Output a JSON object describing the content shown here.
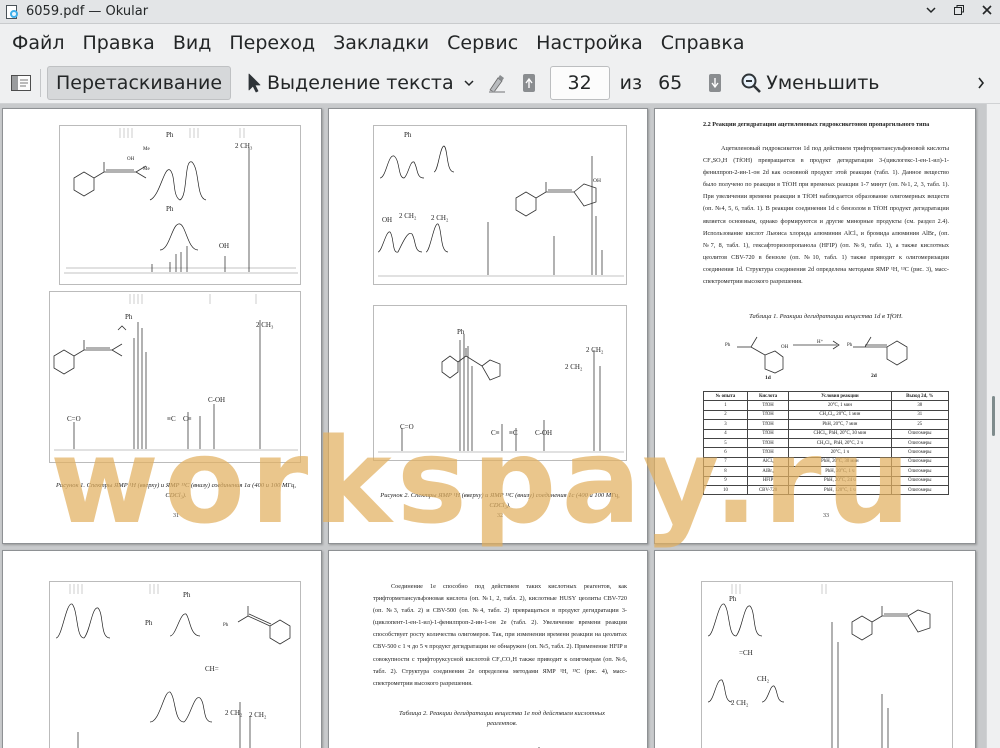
{
  "window": {
    "title": "6059.pdf  — Okular"
  },
  "menubar": {
    "items": [
      "Файл",
      "Правка",
      "Вид",
      "Переход",
      "Закладки",
      "Сервис",
      "Настройка",
      "Справка"
    ]
  },
  "toolbar": {
    "browse_label": "Перетаскивание",
    "select_label": "Выделение текста",
    "page_value": "32",
    "of_label": "из",
    "total_pages": "65",
    "zoom_out_label": "Уменьшить"
  },
  "watermark": "workspay.ru",
  "pages": {
    "p31": {
      "number": "31",
      "caption": "Рисунок 1. Спектры ЯМР ¹H (вверху) и ЯМР ¹³C (внизу) соединения 1a (400 и 100 МГц, CDCl₃).",
      "labels": {
        "ph_top": "Ph",
        "ch3_top": "2 CH₃",
        "ph_mid": "Ph",
        "oh": "OH",
        "me1": "Me",
        "me2": "Me",
        "oh_mol": "OH",
        "ph_c13": "Ph",
        "ch3_c13": "2 CH₃",
        "co": "C=O",
        "cc1": "≡C",
        "cc2": "C≡",
        "coh": "C-OH"
      }
    },
    "p32": {
      "number": "32",
      "caption": "Рисунок 2. Спектры ЯМР ¹H (вверху) и ЯМР ¹³C (внизу) соединения 1c (400 и 100 МГц, CDCl₃).",
      "labels": {
        "ph": "Ph",
        "oh": "OH",
        "ch2_a": "2 CH₂",
        "ch2_b": "2 CH₂",
        "oh_mol": "OH",
        "ph_c13": "Ph",
        "ch2_c13a": "2 CH₂",
        "ch2_c13b": "2 CH₂",
        "co": "C=O",
        "cc1": "C≡",
        "cc2": "≡C",
        "coh": "C-OH"
      }
    },
    "p33": {
      "number": "33",
      "heading": "2.2 Реакции дегидратации ацетиленовых гидроксикетонов пропаргильного типа",
      "paragraphs": [
        "Ацетиленовый гидроксикетон 1d под действием трифторметансульфоновой кислоты CF₃SO₃H (TfOH) превращается в продукт дегидратации 3-(циклогекс-1-ен-1-ил)-1-фенилпроп-2-ин-1-он 2d как основной продукт этой реакции (табл. 1). Данное вещество было получено по реакции в TfOH при временах реакции 1-7 минут (оп. №1, 2, 3, табл. 1). При увеличении времени реакции в TfOH наблюдается образование олигомерных веществ (оп. №4, 5, 6, табл. 1). В реакции соединения 1d с бензолом в TfOH продукт дегидратации является основным, однако формируются и другие минорные продукты (см. раздел 2.4). Использование кислот Льюиса хлорида алюминия AlCl₃ и бромида алюминия AlBr₃ (оп. №7, 8, табл. 1), гексафторизопропанола (HFIP) (оп. №9, табл. 1), а также кислотных цеолитов CBV-720 в бензоле (оп. №10, табл. 1) также приводит к олигомеризации соединения 1d. Структура соединения 2d определена методами ЯМР ¹H, ¹³C (рис. 3), масс-спектрометрии высокого разрешения."
      ],
      "table_caption": "Таблица 1. Реакции дегидратации вещества 1d в TfOH.",
      "scheme": {
        "r1": "1d",
        "r2": "2d",
        "ph": "Ph",
        "oh": "OH",
        "h": "H⁺"
      },
      "table": {
        "headers": [
          "№ опыта",
          "Кислота",
          "Условия реакции",
          "Выход 2d, %"
        ],
        "rows": [
          [
            "1",
            "TfOH",
            "20°C, 1 мин",
            "38"
          ],
          [
            "2",
            "TfOH",
            "CH₂Cl₂, 20°C, 1 мин",
            "31"
          ],
          [
            "3",
            "TfOH",
            "PhH, 20°C, 7 мин",
            "25"
          ],
          [
            "4",
            "TfOH",
            "CHCl₃, PhH, 20°C, 30 мин",
            "Олигомеры"
          ],
          [
            "5",
            "TfOH",
            "CH₂Cl₂, PhH, 20°C, 2 ч",
            "Олигомеры"
          ],
          [
            "6",
            "TfOH",
            "20°C, 1 ч",
            "Олигомеры"
          ],
          [
            "7",
            "AlCl₃",
            "PhH, 20°C, 30 мин",
            "Олигомеры"
          ],
          [
            "8",
            "AlBr₃",
            "PhH, 20°C, 1 ч",
            "Олигомеры"
          ],
          [
            "9",
            "HFIP",
            "PhH, 20°C, 24 ч",
            "Олигомеры"
          ],
          [
            "10",
            "CBV-720",
            "PhH, 120°C, 1 ч",
            "Олигомеры"
          ]
        ]
      }
    },
    "p34": {
      "labels": {
        "ph1": "Ph",
        "ph2": "Ph",
        "ph_mol": "Ph",
        "ch": "CH=",
        "ch2_a": "2 CH₂",
        "ch2_b": "2 CH₂"
      }
    },
    "p35": {
      "paragraph": "Соединение 1e способно под действием таких кислотных реагентов, как трифторметансульфоновая кислота (оп. №1, 2, табл. 2), кислотные HUSY цеолиты CBV-720 (оп. №3, табл. 2) и CBV-500 (оп. №4, табл. 2) превращаться в продукт дегидратации 3-(циклопент-1-ен-1-ил)-1-фенилпроп-2-ин-1-он 2e (табл. 2). Увеличение времени реакции способствует росту количества олигомеров. Так, при изменении времени реакции на цеолитах CBV-500 с 1 ч до 5 ч продукт дегидратации не обнаружен (оп. №5, табл. 2). Применение HFIP в совокупности с трифторуксусной кислотой CF₃CO₂H также приводит к олигомерам (оп. №6, табл. 2). Структура соединения 2e определена методами ЯМР ¹H, ¹³C (рис. 4), масс-спектрометрии высокого разрешения.",
      "table_caption": "Таблица 2. Реакции дегидратации вещества 1e под действием кислотных реагентов."
    },
    "p36": {
      "labels": {
        "ph": "Ph",
        "ch": "=CH",
        "ch2_a": "CH₂",
        "ch2_b": "2 CH₂"
      }
    }
  }
}
